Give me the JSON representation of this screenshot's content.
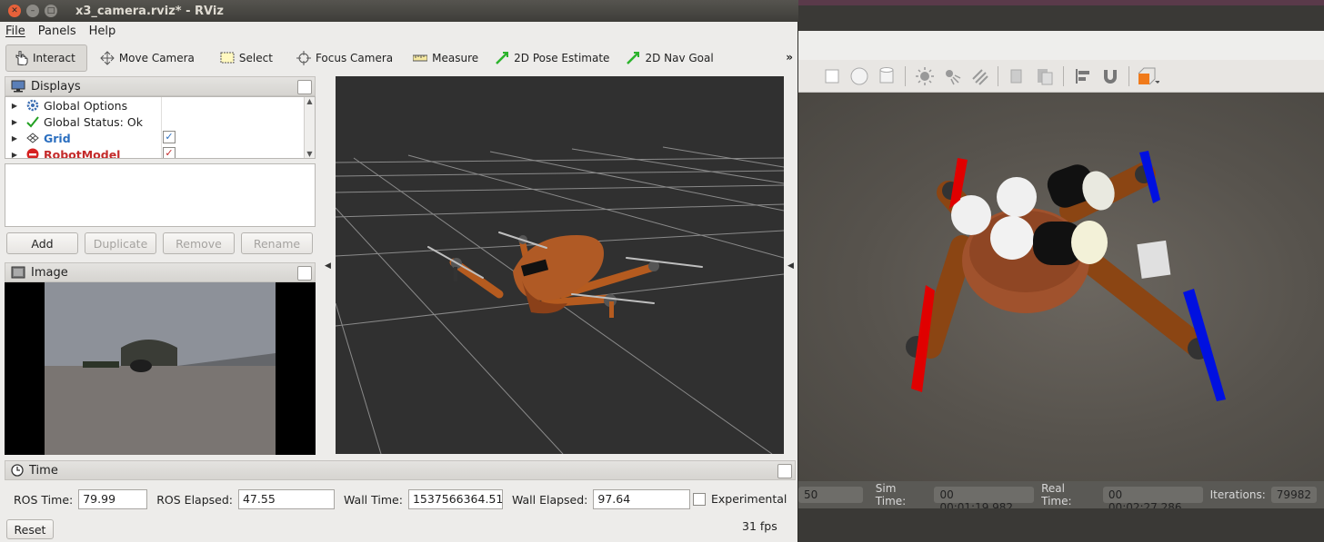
{
  "window": {
    "title": "x3_camera.rviz* - RViz"
  },
  "menu": {
    "file": "File",
    "panels": "Panels",
    "help": "Help"
  },
  "toolbar": {
    "interact": "Interact",
    "move_camera": "Move Camera",
    "select": "Select",
    "focus_camera": "Focus Camera",
    "measure": "Measure",
    "pose_estimate": "2D Pose Estimate",
    "nav_goal": "2D Nav Goal",
    "more": "»"
  },
  "displays": {
    "title": "Displays",
    "items": [
      {
        "label": "Global Options",
        "icon": "gear-icon",
        "checked": null
      },
      {
        "label": "Global Status: Ok",
        "icon": "check-icon",
        "checked": null
      },
      {
        "label": "Grid",
        "icon": "grid-icon",
        "checked": true
      },
      {
        "label": "RobotModel",
        "icon": "error-icon",
        "checked": true
      }
    ],
    "buttons": {
      "add": "Add",
      "duplicate": "Duplicate",
      "remove": "Remove",
      "rename": "Rename"
    }
  },
  "image_panel": {
    "title": "Image"
  },
  "time_panel": {
    "title": "Time",
    "ros_time_label": "ROS Time:",
    "ros_time": "79.99",
    "ros_elapsed_label": "ROS Elapsed:",
    "ros_elapsed": "47.55",
    "wall_time_label": "Wall Time:",
    "wall_time": "1537566364.51",
    "wall_elapsed_label": "Wall Elapsed:",
    "wall_elapsed": "97.64",
    "experimental": "Experimental",
    "reset": "Reset",
    "fps": "31 fps"
  },
  "gazebo": {
    "real_time_factor_partial": "50",
    "sim_time_label": "Sim Time:",
    "sim_time": "00 00:01:19.982",
    "real_time_label": "Real Time:",
    "real_time": "00 00:02:27.286",
    "iterations_label": "Iterations:",
    "iterations": "79982"
  },
  "colors": {
    "grid_label": "#2b6fc0",
    "robotmodel_label": "#c42a2a",
    "drone_body": "#a0522d",
    "prop_red": "#e00000",
    "prop_blue": "#0010e0"
  }
}
